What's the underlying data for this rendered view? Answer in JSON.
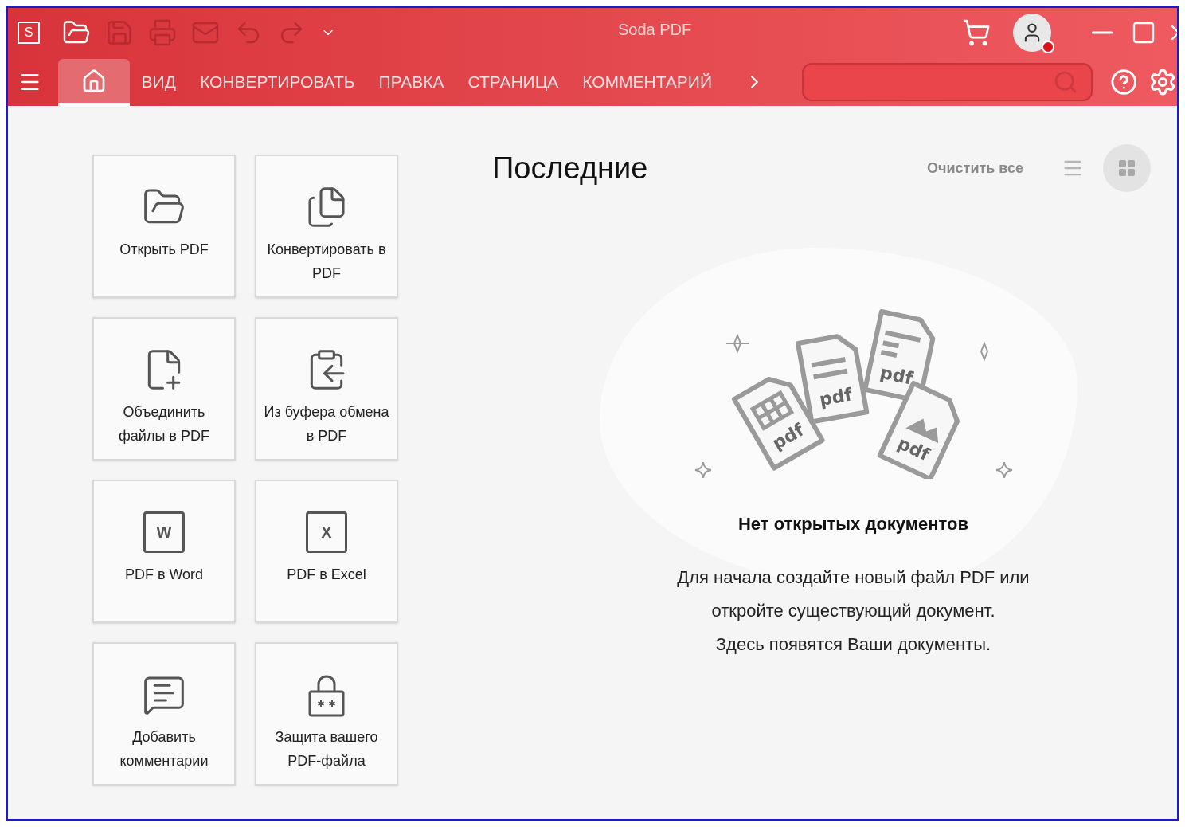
{
  "window": {
    "title": "Soda PDF",
    "logo_letter": "S"
  },
  "quick_toolbar": [
    {
      "kind": "open",
      "disabled": false
    },
    {
      "kind": "save",
      "disabled": true
    },
    {
      "kind": "print",
      "disabled": true
    },
    {
      "kind": "mail",
      "disabled": true
    },
    {
      "kind": "undo",
      "disabled": true
    },
    {
      "kind": "redo",
      "disabled": true
    },
    {
      "kind": "more",
      "disabled": false
    }
  ],
  "account": {
    "notification": true
  },
  "tabs": [
    {
      "kind": "home",
      "selected": true
    },
    {
      "label": "ВИД",
      "selected": false
    },
    {
      "label": "КОНВЕРТИРОВАТЬ",
      "selected": false
    },
    {
      "label": "ПРАВКА",
      "selected": false
    },
    {
      "label": "СТРАНИЦА",
      "selected": false
    },
    {
      "label": "КОММЕНТАРИЙ",
      "selected": false
    }
  ],
  "actions": [
    {
      "kind": "open",
      "label": "Открыть PDF"
    },
    {
      "kind": "convert",
      "label": "Конвертировать в PDF"
    },
    {
      "kind": "merge",
      "label": "Объединить файлы в PDF"
    },
    {
      "kind": "clipboard",
      "label": "Из буфера обмена в PDF"
    },
    {
      "kind": "word",
      "label": "PDF в Word",
      "icon_text": "W"
    },
    {
      "kind": "excel",
      "label": "PDF в Excel",
      "icon_text": "X"
    },
    {
      "kind": "comment",
      "label": "Добавить комментарии"
    },
    {
      "kind": "protect",
      "label": "Защита вашего PDF-файла"
    }
  ],
  "recent": {
    "title": "Последние",
    "clear_all": "Очистить все",
    "views": [
      {
        "kind": "list",
        "selected": false
      },
      {
        "kind": "grid",
        "selected": true
      }
    ],
    "illustration_labels": [
      "pdf",
      "pdf",
      "pdf",
      "pdf"
    ],
    "empty_title": "Нет открытых документов",
    "empty_lines": [
      "Для начала создайте новый файл PDF или",
      "откройте существующий документ.",
      "Здесь появятся Ваши документы."
    ]
  }
}
